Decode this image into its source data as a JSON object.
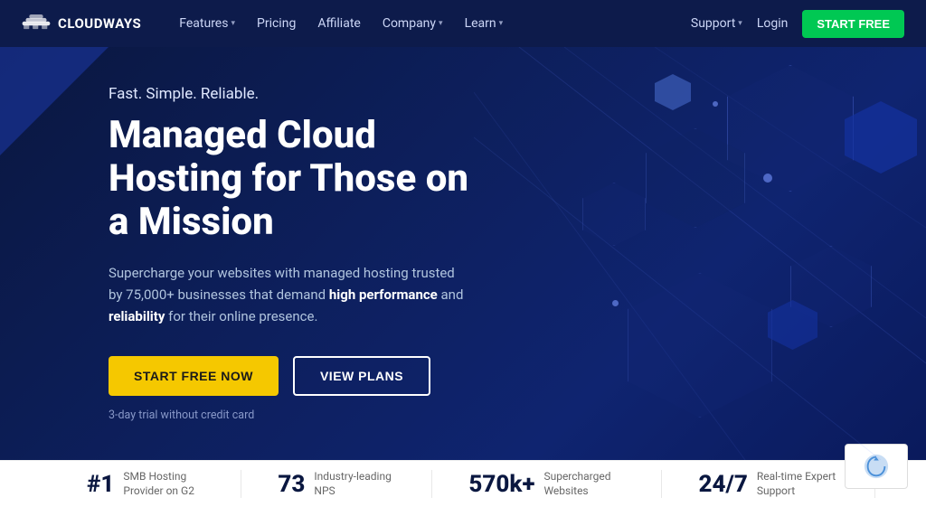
{
  "brand": {
    "name": "CLOUDWAYS",
    "logo_alt": "Cloudways logo"
  },
  "navbar": {
    "features_label": "Features",
    "pricing_label": "Pricing",
    "affiliate_label": "Affiliate",
    "company_label": "Company",
    "learn_label": "Learn",
    "support_label": "Support",
    "login_label": "Login",
    "start_free_label": "START FREE"
  },
  "hero": {
    "subtitle": "Fast. Simple. Reliable.",
    "title": "Managed Cloud Hosting for Those on a Mission",
    "description_before": "Supercharge your websites with managed hosting trusted by 75,000+ businesses that demand ",
    "description_bold1": "high performance",
    "description_mid": " and ",
    "description_bold2": "reliability",
    "description_after": " for their online presence.",
    "start_btn": "START FREE NOW",
    "plans_btn": "VIEW PLANS",
    "trial_note": "3-day trial without credit card"
  },
  "stats": [
    {
      "number": "#1",
      "label": "SMB Hosting Provider on G2"
    },
    {
      "number": "73",
      "label": "Industry-leading NPS"
    },
    {
      "number": "570k+",
      "label": "Supercharged Websites"
    },
    {
      "number": "24/7",
      "label": "Real-time Expert Support"
    }
  ]
}
